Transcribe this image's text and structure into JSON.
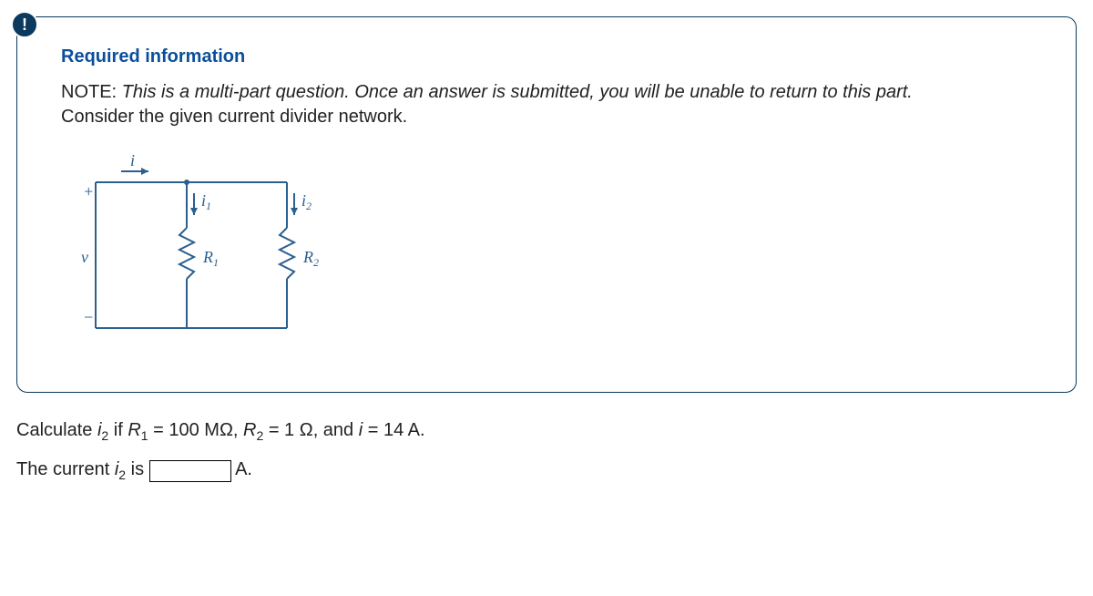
{
  "badge": {
    "symbol": "!"
  },
  "heading": "Required information",
  "note_prefix": "NOTE: ",
  "note_italic": "This is a multi-part question. Once an answer is submitted, you will be unable to return to this part.",
  "second_line": "Consider the given current divider network.",
  "diagram": {
    "i_label": "i",
    "plus": "+",
    "minus": "−",
    "v_label": "v",
    "i1_label": "i",
    "i1_sub": "1",
    "i2_label": "i",
    "i2_sub": "2",
    "R1_label": "R",
    "R1_sub": "1",
    "R2_label": "R",
    "R2_sub": "2"
  },
  "question": {
    "calc_pre": "Calculate ",
    "i2_var": "i",
    "i2_sub": "2",
    "if_text": " if ",
    "R1_var": "R",
    "R1_sub": "1",
    "R1_val": " = 100 MΩ, ",
    "R2_var": "R",
    "R2_sub": "2",
    "R2_val": " = 1 Ω, and ",
    "i_var": "i",
    "i_val": " = 14 A."
  },
  "answer": {
    "pre": "The current ",
    "i2_var": "i",
    "i2_sub": "2",
    "mid": " is ",
    "unit": "A.",
    "value": ""
  }
}
